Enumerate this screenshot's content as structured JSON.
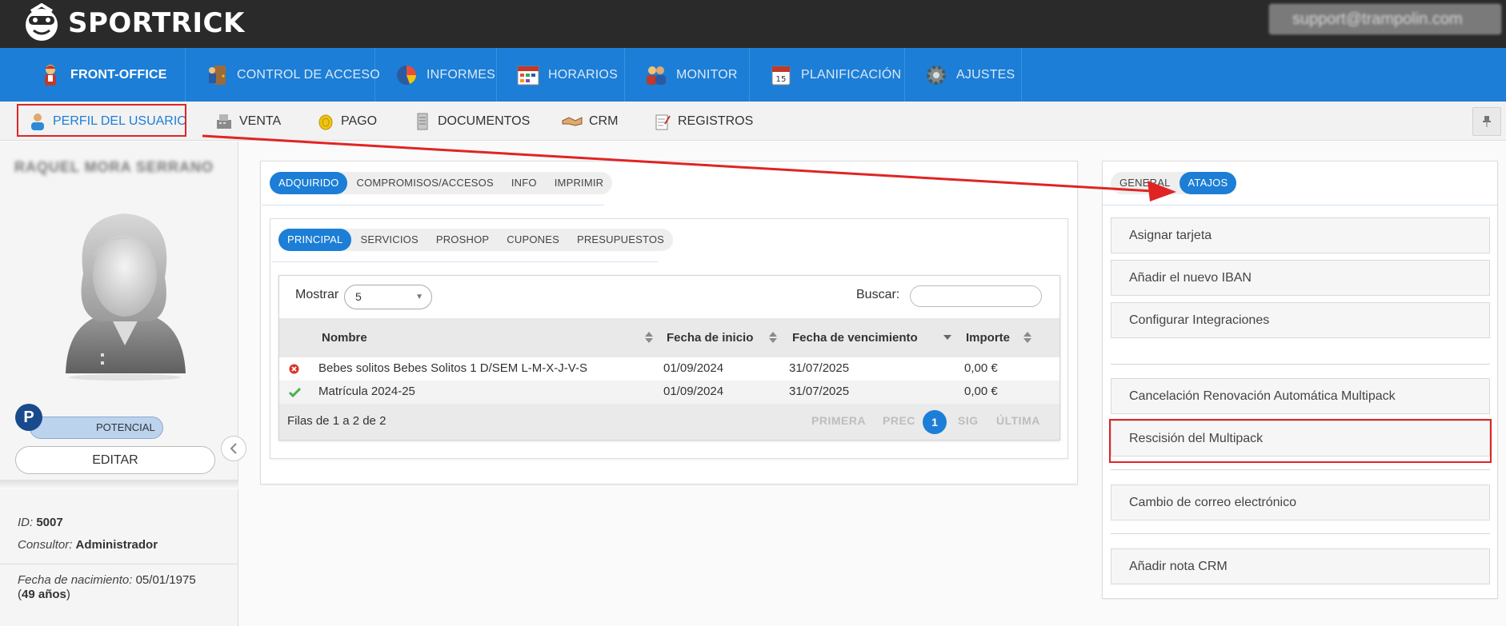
{
  "app": {
    "brand": "SPORTRICK",
    "user_email": "support@trampolin.com"
  },
  "main_nav": {
    "items": [
      {
        "label": "FRONT-OFFICE",
        "icon": "front-office-person-icon",
        "active": true
      },
      {
        "label": "CONTROL DE ACCESO",
        "icon": "access-control-icon",
        "active": false
      },
      {
        "label": "INFORMES",
        "icon": "pie-chart-icon",
        "active": false
      },
      {
        "label": "HORARIOS",
        "icon": "calendar-grid-icon",
        "active": false
      },
      {
        "label": "MONITOR",
        "icon": "people-group-icon",
        "active": false
      },
      {
        "label": "PLANIFICACIÓN",
        "icon": "calendar-15-icon",
        "active": false
      },
      {
        "label": "AJUSTES",
        "icon": "gear-icon",
        "active": false
      }
    ]
  },
  "sub_nav": {
    "items": [
      {
        "label": "PERFIL DEL USUARIO",
        "icon": "user-profile-icon",
        "active": true
      },
      {
        "label": "VENTA",
        "icon": "cash-register-icon",
        "active": false
      },
      {
        "label": "PAGO",
        "icon": "coin-icon",
        "active": false
      },
      {
        "label": "DOCUMENTOS",
        "icon": "document-stack-icon",
        "active": false
      },
      {
        "label": "CRM",
        "icon": "handshake-icon",
        "active": false
      },
      {
        "label": "REGISTROS",
        "icon": "notepad-icon",
        "active": false
      }
    ]
  },
  "profile": {
    "name": "RAQUEL MORA SERRANO",
    "status_letter": "P",
    "status_label": "POTENCIAL",
    "edit_label": "EDITAR",
    "id_label": "ID:",
    "id_value": "5007",
    "consultor_label": "Consultor:",
    "consultor_value": "Administrador",
    "birth_label": "Fecha de nacimiento:",
    "birth_value": "05/01/1975",
    "age_value": "49 años",
    "age_open": "(",
    "age_close": ")"
  },
  "center": {
    "tabs_main": [
      {
        "label": "ADQUIRIDO",
        "active": true
      },
      {
        "label": "COMPROMISOS/ACCESOS",
        "active": false
      },
      {
        "label": "INFO",
        "active": false
      },
      {
        "label": "IMPRIMIR",
        "active": false
      }
    ],
    "tabs_sub": [
      {
        "label": "PRINCIPAL",
        "active": true
      },
      {
        "label": "SERVICIOS",
        "active": false
      },
      {
        "label": "PROSHOP",
        "active": false
      },
      {
        "label": "CUPONES",
        "active": false
      },
      {
        "label": "PRESUPUESTOS",
        "active": false
      }
    ],
    "table": {
      "show_label": "Mostrar",
      "page_size": "5",
      "search_label": "Buscar:",
      "search_value": "",
      "columns": [
        "Nombre",
        "Fecha de inicio",
        "Fecha de vencimiento",
        "Importe"
      ],
      "rows": [
        {
          "status": "error",
          "status_icon": "red-x-circle-icon",
          "nombre": "Bebes solitos Bebes Solitos 1 D/SEM L-M-X-J-V-S",
          "inicio": "01/09/2024",
          "vencimiento": "31/07/2025",
          "importe": "0,00 €"
        },
        {
          "status": "ok",
          "status_icon": "green-check-icon",
          "nombre": "Matrícula 2024-25",
          "inicio": "01/09/2024",
          "vencimiento": "31/07/2025",
          "importe": "0,00 €"
        }
      ],
      "footer_info": "Filas de 1 a 2 de 2",
      "pagination": {
        "first": "PRIMERA",
        "prev": "PREC",
        "current": "1",
        "next": "SIG",
        "last": "ÚLTIMA"
      }
    }
  },
  "right": {
    "tabs": [
      {
        "label": "GENERAL",
        "active": false
      },
      {
        "label": "ATAJOS",
        "active": true
      }
    ],
    "shortcuts_group1": [
      "Asignar tarjeta",
      "Añadir el nuevo IBAN",
      "Configurar Integraciones"
    ],
    "shortcuts_group2": [
      "Cancelación Renovación Automática Multipack",
      "Rescisión del Multipack"
    ],
    "shortcuts_group3": [
      "Cambio de correo electrónico"
    ],
    "shortcuts_group4": [
      "Añadir nota CRM"
    ]
  },
  "annotations": {
    "color": "#e02424"
  },
  "colors": {
    "topbar": "#2a2a2a",
    "nav_blue": "#1c7ed6",
    "status_badge": "#194b8c"
  }
}
